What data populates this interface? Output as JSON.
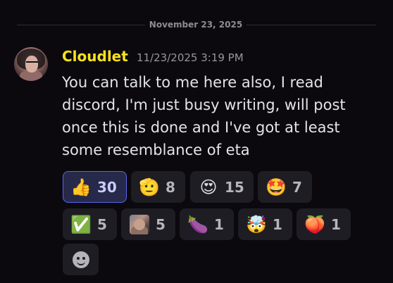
{
  "divider": {
    "date": "November 23, 2025"
  },
  "message": {
    "author": "Cloudlet",
    "timestamp": "11/23/2025 3:19 PM",
    "text": "You can talk to me here also, I read discord, I'm just busy writing, will post once this is done and I've got at least some resemblance of eta",
    "author_color": "#f8e21a"
  },
  "reactions": [
    {
      "emoji": "👍",
      "icon": "thumbs-up-icon",
      "count": "30",
      "active": true
    },
    {
      "emoji": "🫡",
      "icon": "saluting-face-icon",
      "count": "8",
      "active": false
    },
    {
      "emoji": "😍",
      "icon": "heart-eyes-icon",
      "count": "15",
      "active": false
    },
    {
      "emoji": "🤩",
      "icon": "star-struck-icon",
      "count": "7",
      "active": false
    },
    {
      "emoji": "✅",
      "icon": "check-mark-icon",
      "count": "5",
      "active": false
    },
    {
      "emoji": "",
      "icon": "custom-image-emoji-icon",
      "count": "5",
      "active": false
    },
    {
      "emoji": "🍆",
      "icon": "eggplant-icon",
      "count": "1",
      "active": false
    },
    {
      "emoji": "🤯",
      "icon": "exploding-head-icon",
      "count": "1",
      "active": false
    },
    {
      "emoji": "🍑",
      "icon": "peach-icon",
      "count": "1",
      "active": false
    }
  ],
  "add_reaction": {
    "icon": "add-reaction-icon"
  }
}
